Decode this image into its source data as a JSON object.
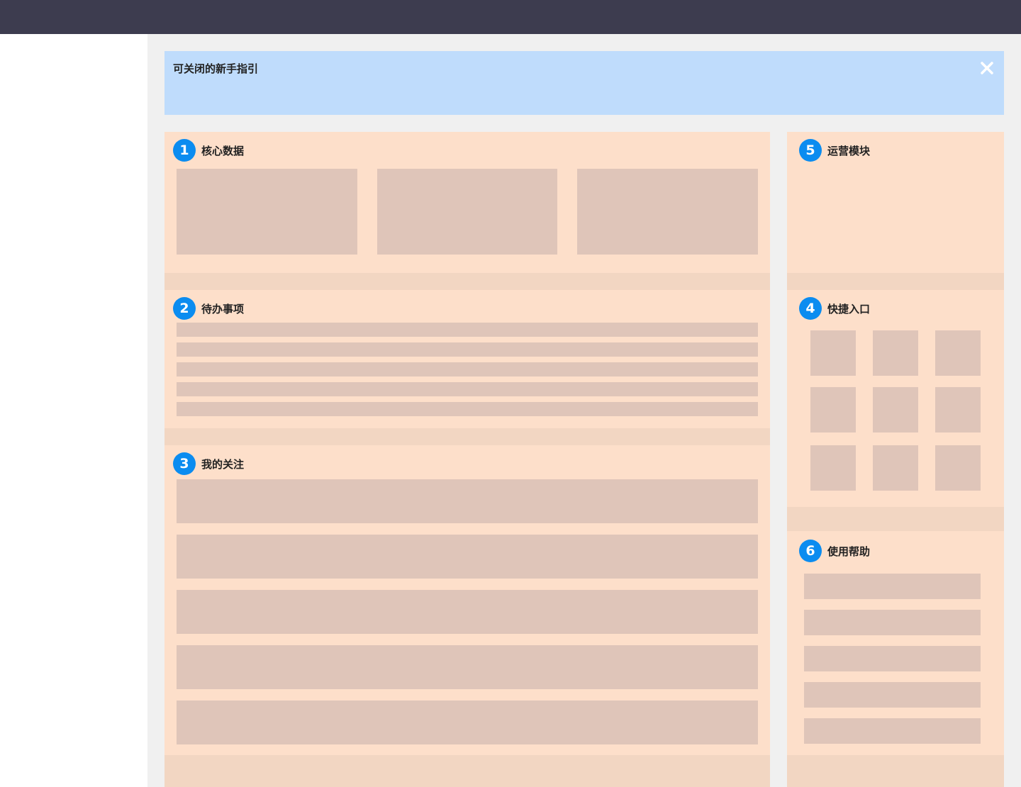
{
  "guide": {
    "title": "可关闭的新手指引",
    "close_icon": "close-icon"
  },
  "modules": [
    {
      "number": "1",
      "title": "核心数据"
    },
    {
      "number": "2",
      "title": "待办事项"
    },
    {
      "number": "3",
      "title": "我的关注"
    },
    {
      "number": "4",
      "title": "快捷入口"
    },
    {
      "number": "5",
      "title": "运营模块"
    },
    {
      "number": "6",
      "title": "使用帮助"
    }
  ],
  "colors": {
    "topbar": "#3d3c4f",
    "guide_background": "#bfdcfc",
    "card_background": "#fddfca",
    "placeholder": "#dfc5b9",
    "badge": "#0b8cf0"
  }
}
